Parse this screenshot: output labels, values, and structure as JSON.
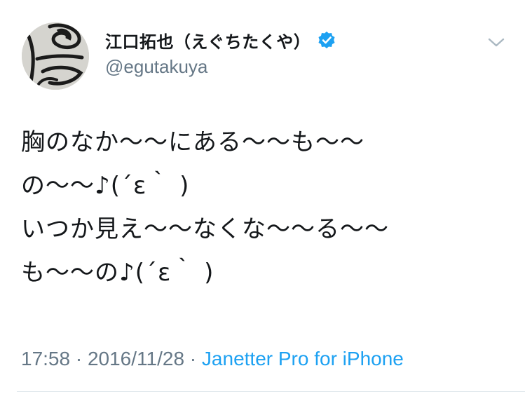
{
  "user": {
    "display_name": "江口拓也（えぐちたくや）",
    "handle": "@egutakuya",
    "verified_icon": "verified-badge-icon",
    "avatar_icon": "avatar-image"
  },
  "tweet": {
    "lines": [
      "胸のなか〜〜にある〜〜も〜〜",
      "の〜〜♪(´ε｀ )",
      "いつか見え〜〜なくな〜〜る〜〜",
      "も〜〜の♪(´ε｀ )"
    ]
  },
  "meta": {
    "time": "17:58",
    "separator1": " · ",
    "date": "2016/11/28",
    "separator2": " · ",
    "source": "Janetter Pro for iPhone"
  },
  "menu": {
    "icon": "chevron-down-icon"
  },
  "colors": {
    "text": "#14171a",
    "secondary": "#657786",
    "link": "#1da1f2",
    "verified": "#1da1f2",
    "divider": "#e1e8ed"
  }
}
